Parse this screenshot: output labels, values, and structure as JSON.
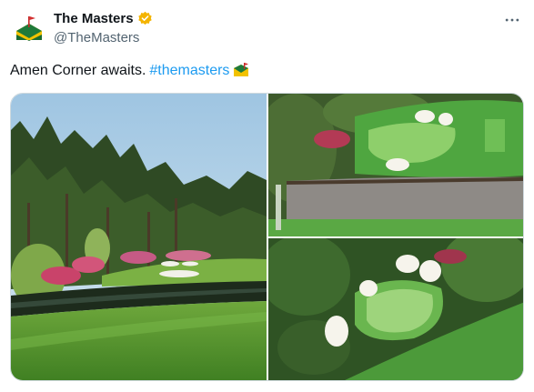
{
  "tweet": {
    "display_name": "The Masters",
    "handle": "@TheMasters",
    "text": "Amen Corner awaits.",
    "hashtag": "#themasters"
  },
  "icons": {
    "avatar": "masters-flag-logo-icon",
    "verified": "verified-badge-icon",
    "more": "more-options-icon",
    "hashtag_emoji": "green-jacket-icon"
  },
  "colors": {
    "verified_badge": "#f4b400",
    "link": "#1d9bf0",
    "secondary_text": "#536471"
  },
  "media": {
    "count": 3,
    "items": [
      "golf-course-photo",
      "aerial-green-photo",
      "aerial-hole-photo"
    ]
  }
}
